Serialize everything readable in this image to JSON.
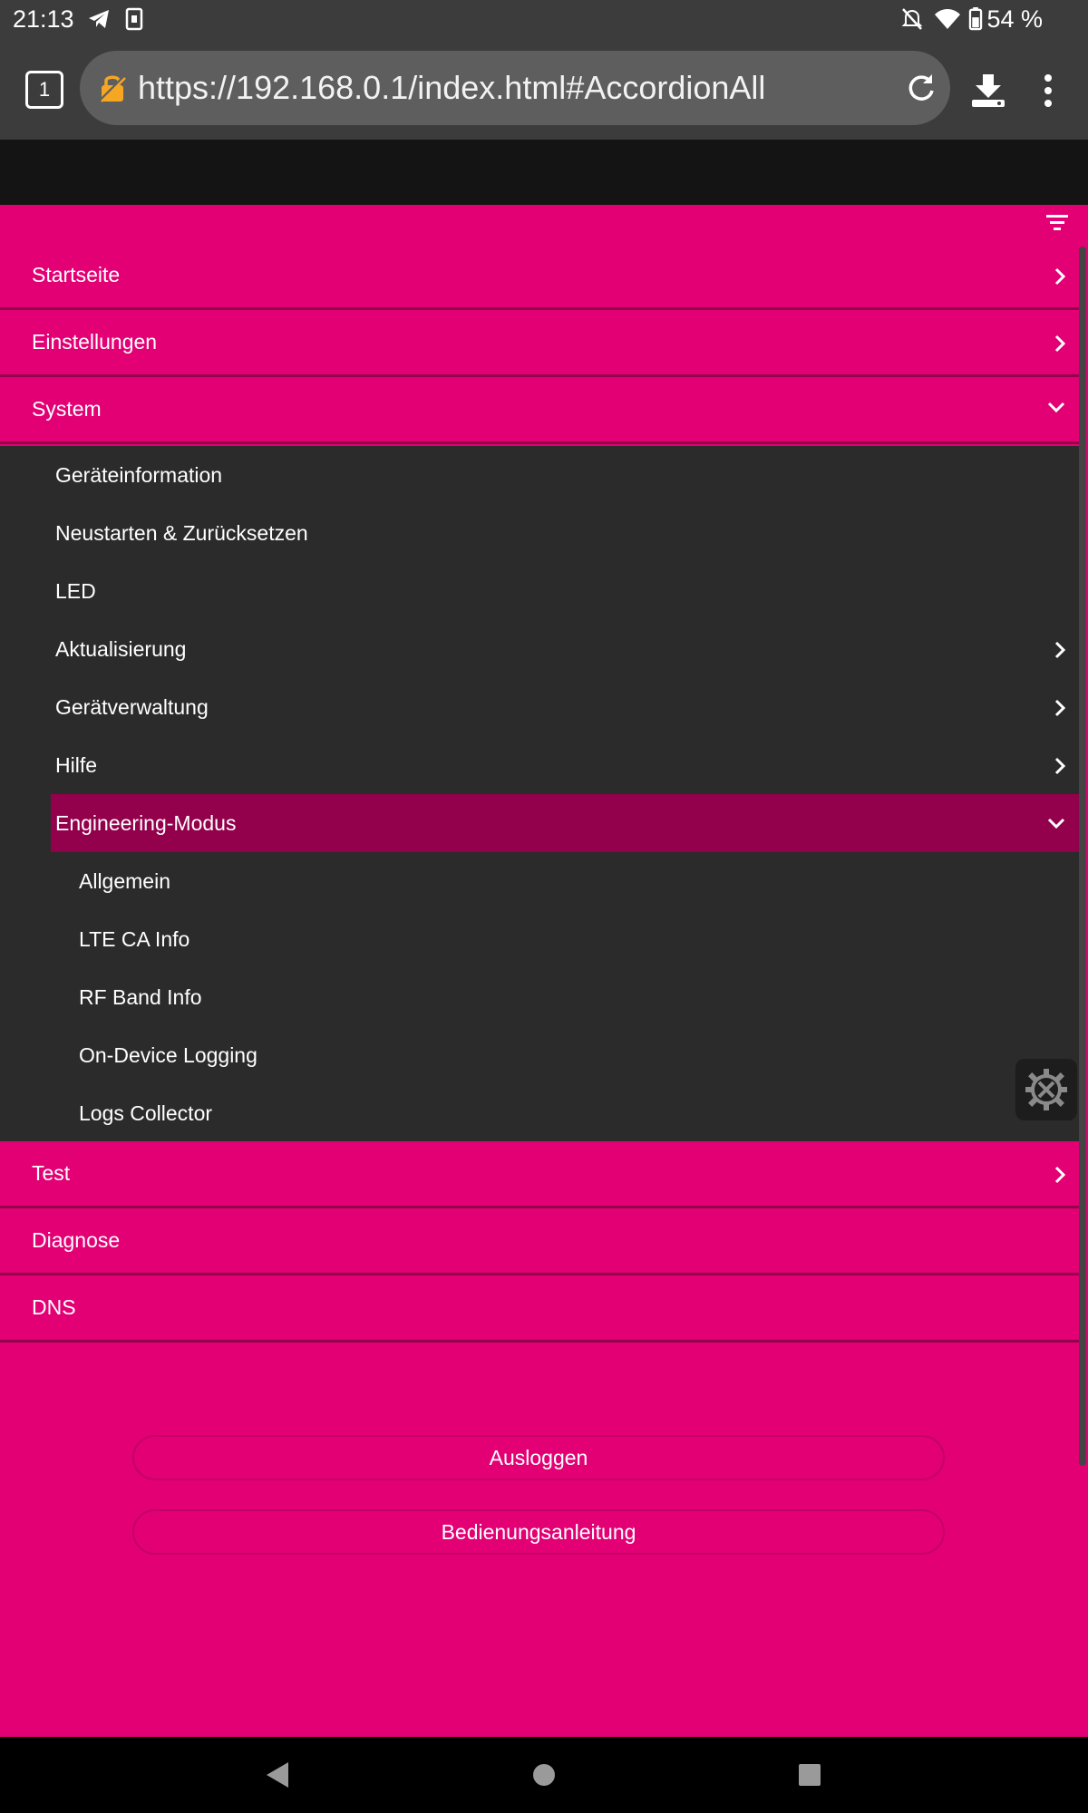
{
  "status_bar": {
    "time": "21:13",
    "battery": "54 %"
  },
  "browser": {
    "tab_count": "1",
    "url": "https://192.168.0.1/index.html#AccordionAll"
  },
  "menu": {
    "top_items": [
      {
        "label": "Startseite"
      },
      {
        "label": "Einstellungen"
      },
      {
        "label": "System"
      }
    ],
    "system_items": [
      {
        "label": "Geräteinformation"
      },
      {
        "label": "Neustarten & Zurücksetzen"
      },
      {
        "label": "LED"
      },
      {
        "label": "Aktualisierung"
      },
      {
        "label": "Gerätverwaltung"
      },
      {
        "label": "Hilfe"
      },
      {
        "label": "Engineering-Modus"
      }
    ],
    "engineering_items": [
      {
        "label": "Allgemein"
      },
      {
        "label": "LTE CA Info"
      },
      {
        "label": "RF Band Info"
      },
      {
        "label": "On-Device Logging"
      },
      {
        "label": "Logs Collector"
      }
    ],
    "bottom_items": [
      {
        "label": "Test"
      },
      {
        "label": "Diagnose"
      },
      {
        "label": "DNS"
      }
    ]
  },
  "buttons": {
    "logout": "Ausloggen",
    "manual": "Bedienungsanleitung"
  },
  "colors": {
    "brand_magenta": "#e20074",
    "active_item": "#93004c",
    "dark_panel": "#2b2b2b"
  }
}
